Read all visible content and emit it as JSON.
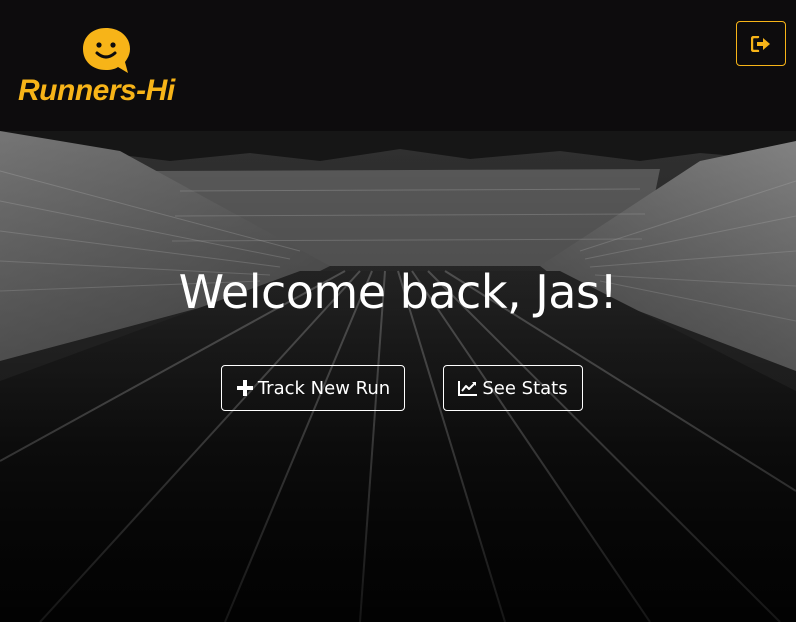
{
  "brand": {
    "name": "Runners-Hi",
    "logo_icon": "smiley-speech-bubble-icon",
    "accent_color": "#f7b418"
  },
  "header": {
    "logout_icon": "sign-out-icon"
  },
  "hero": {
    "background": "stadium-running-track-photo",
    "greeting": "Welcome back, Jas!",
    "actions": [
      {
        "label": "Track New Run",
        "icon": "plus-icon"
      },
      {
        "label": "See Stats",
        "icon": "line-chart-icon"
      }
    ]
  }
}
